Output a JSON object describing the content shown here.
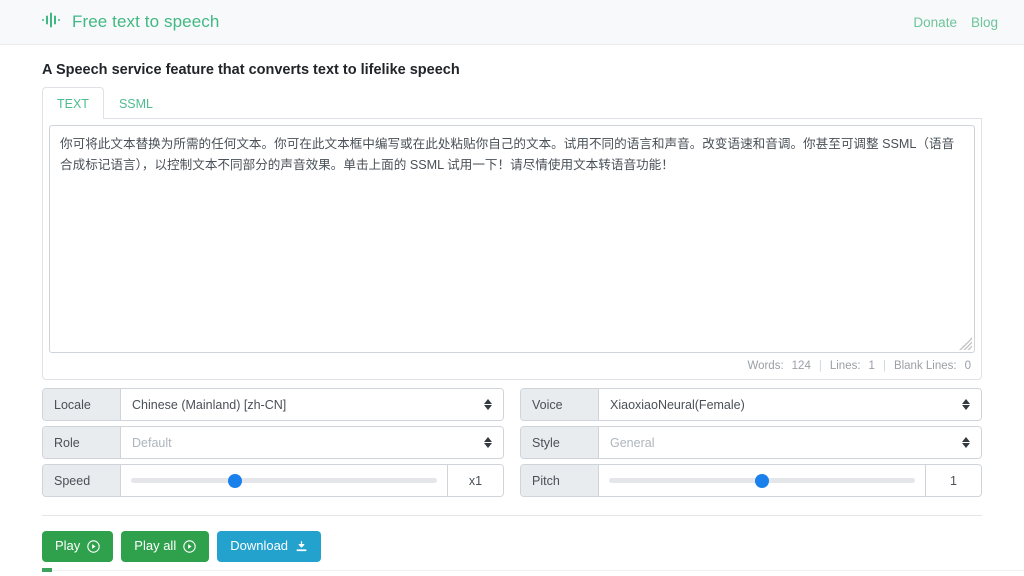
{
  "brand": {
    "name": "Free text to speech",
    "icon": "audio-waveform-icon",
    "color": "#41b883"
  },
  "nav": {
    "links": [
      {
        "label": "Donate"
      },
      {
        "label": "Blog"
      }
    ]
  },
  "page": {
    "title": "A Speech service feature that converts text to lifelike speech"
  },
  "tabs": [
    {
      "label": "TEXT",
      "active": true
    },
    {
      "label": "SSML",
      "active": false
    }
  ],
  "editor": {
    "value": "你可将此文本替换为所需的任何文本。你可在此文本框中编写或在此处粘贴你自己的文本。试用不同的语言和声音。改变语速和音调。你甚至可调整 SSML（语音合成标记语言），以控制文本不同部分的声音效果。单击上面的 SSML 试用一下！请尽情使用文本转语音功能！",
    "placeholder": ""
  },
  "counts": {
    "words_label": "Words:",
    "words_value": "124",
    "lines_label": "Lines:",
    "lines_value": "1",
    "blank_lines_label": "Blank Lines:",
    "blank_lines_value": "0",
    "separator": "|"
  },
  "controls": {
    "locale": {
      "label": "Locale",
      "value": "Chinese (Mainland) [zh-CN]",
      "disabled": false
    },
    "voice": {
      "label": "Voice",
      "value": "XiaoxiaoNeural(Female)",
      "disabled": false
    },
    "role": {
      "label": "Role",
      "value": "Default",
      "disabled": true
    },
    "style": {
      "label": "Style",
      "value": "General",
      "disabled": true
    },
    "speed": {
      "label": "Speed",
      "value": "x1",
      "knob_percent": 34
    },
    "pitch": {
      "label": "Pitch",
      "value": "1",
      "knob_percent": 50
    }
  },
  "actions": [
    {
      "label": "Play",
      "icon": "play-circle-icon",
      "color": "#2fa14c"
    },
    {
      "label": "Play all",
      "icon": "play-circle-icon",
      "color": "#2fa14c"
    },
    {
      "label": "Download",
      "icon": "download-icon",
      "color": "#23a2ce"
    }
  ]
}
